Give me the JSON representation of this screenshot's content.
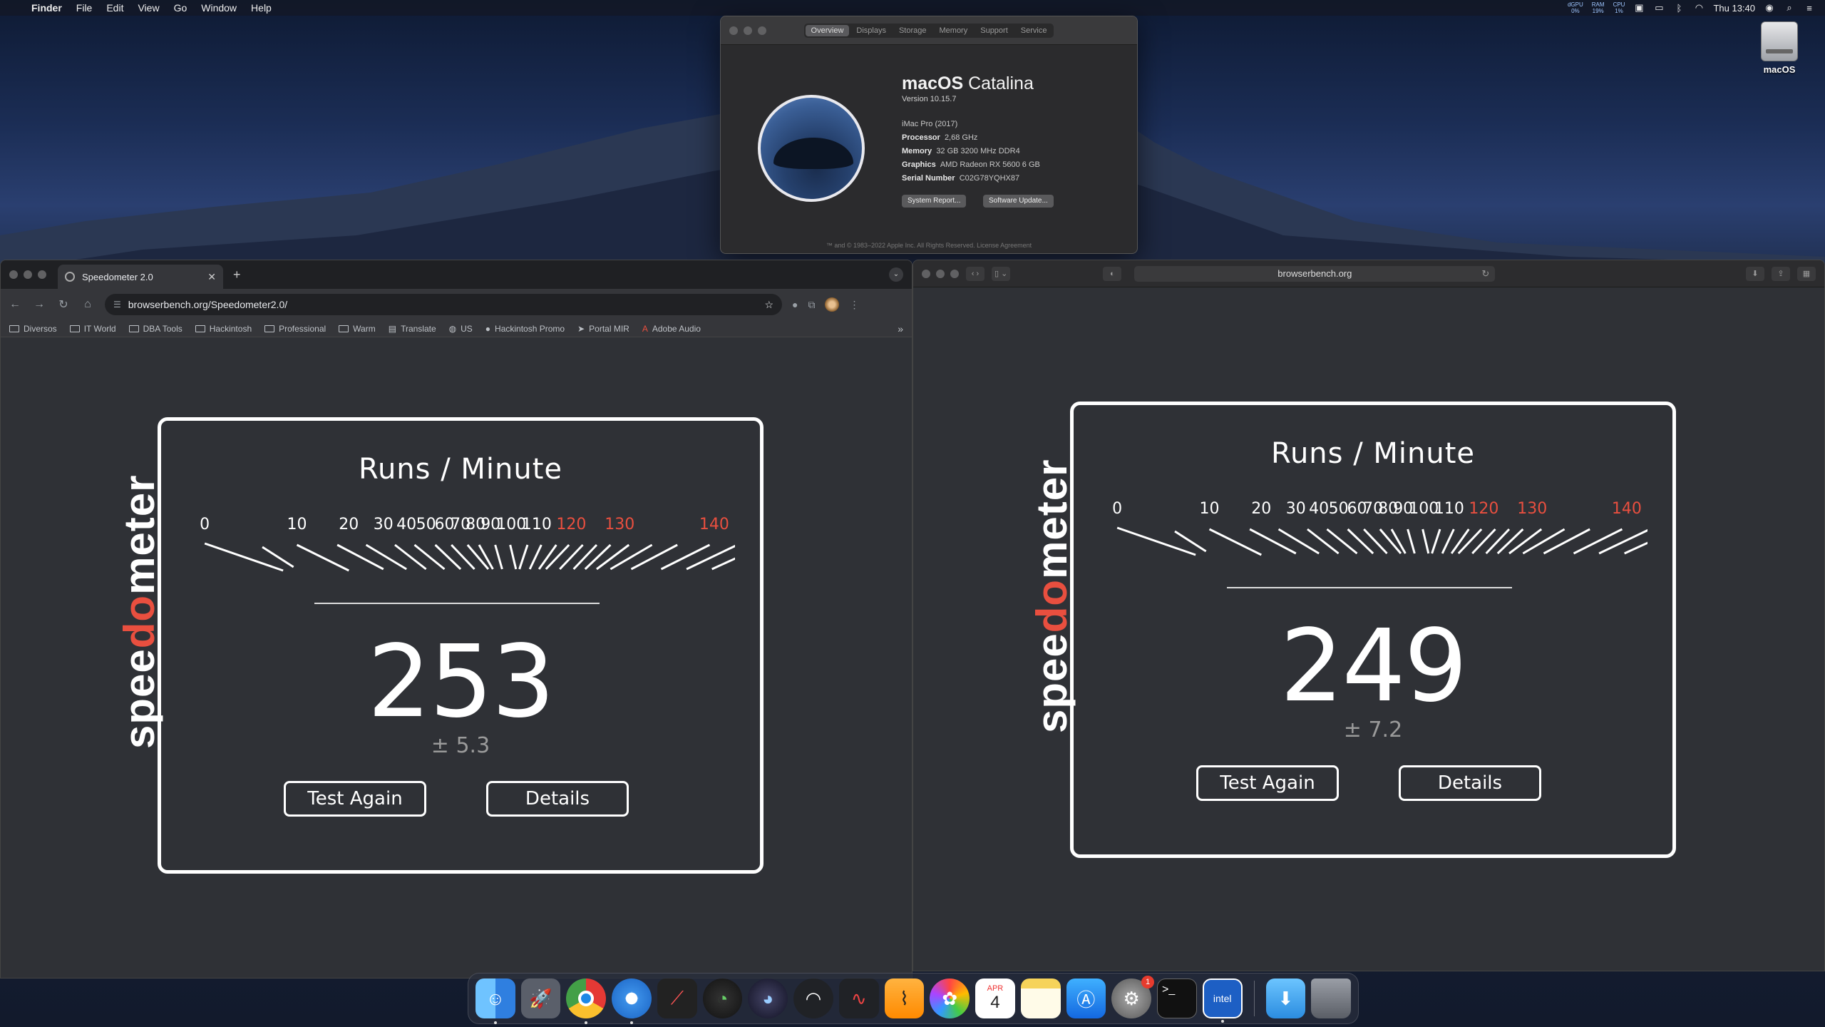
{
  "menubar": {
    "app": "Finder",
    "items": [
      "File",
      "Edit",
      "View",
      "Go",
      "Window",
      "Help"
    ],
    "stats": [
      {
        "label": "dGPU",
        "value": "0%"
      },
      {
        "label": "RAM",
        "value": "19%"
      },
      {
        "label": "CPU",
        "value": "1%"
      }
    ],
    "clock": "Thu 13:40"
  },
  "desktop": {
    "disk_label": "macOS"
  },
  "about": {
    "tabs": [
      "Overview",
      "Displays",
      "Storage",
      "Memory",
      "Support",
      "Service"
    ],
    "active_tab": 0,
    "os_name_bold": "macOS",
    "os_name_light": "Catalina",
    "version": "Version 10.15.7",
    "model": "iMac Pro (2017)",
    "specs": [
      {
        "k": "Processor",
        "v": "2,68 GHz"
      },
      {
        "k": "Memory",
        "v": "32 GB 3200 MHz DDR4"
      },
      {
        "k": "Graphics",
        "v": "AMD Radeon RX 5600 6 GB"
      },
      {
        "k": "Serial Number",
        "v": "C02G78YQHX87"
      }
    ],
    "btn_report": "System Report...",
    "btn_update": "Software Update...",
    "copyright": "™ and © 1983–2022 Apple Inc. All Rights Reserved. License Agreement"
  },
  "chrome": {
    "tab_title": "Speedometer 2.0",
    "url": "browserbench.org/Speedometer2.0/",
    "bookmarks": [
      "Diversos",
      "IT World",
      "DBA Tools",
      "Hackintosh",
      "Professional",
      "Warm",
      "Translate",
      "US",
      "Hackintosh Promo",
      "Portal MIR",
      "Adobe Audio"
    ],
    "speedometer": {
      "logo_a": "spee",
      "logo_b": "do",
      "logo_c": "meter",
      "title": "Runs / Minute",
      "score": "253",
      "error": "± 5.3",
      "btn_again": "Test Again",
      "btn_details": "Details"
    }
  },
  "safari": {
    "url": "browserbench.org",
    "speedometer": {
      "logo_a": "spee",
      "logo_b": "do",
      "logo_c": "meter",
      "title": "Runs / Minute",
      "score": "249",
      "error": "± 7.2",
      "btn_again": "Test Again",
      "btn_details": "Details"
    }
  },
  "gauge": {
    "labels": [
      "0",
      "10",
      "20",
      "30",
      "40",
      "50",
      "60",
      "70",
      "80",
      "90",
      "100",
      "110",
      "120",
      "130",
      "140"
    ],
    "red_from": "120",
    "accent": "#e94f3f",
    "needle_color": "#f0a030"
  },
  "dock": {
    "apps": [
      "finder-icon",
      "launchpad-icon",
      "chrome-icon",
      "safari-icon",
      "xnu-icon",
      "istat-icon",
      "speedometer-icon",
      "performance-icon",
      "audio-icon",
      "activity-icon",
      "photos-icon",
      "calendar-icon",
      "notes-icon",
      "appstore-icon",
      "settings-icon",
      "terminal-icon",
      "intel-power-gadget-icon",
      "downloads-icon",
      "trash-icon"
    ],
    "calendar_month": "APR",
    "calendar_day": "4",
    "settings_badge": "1"
  }
}
